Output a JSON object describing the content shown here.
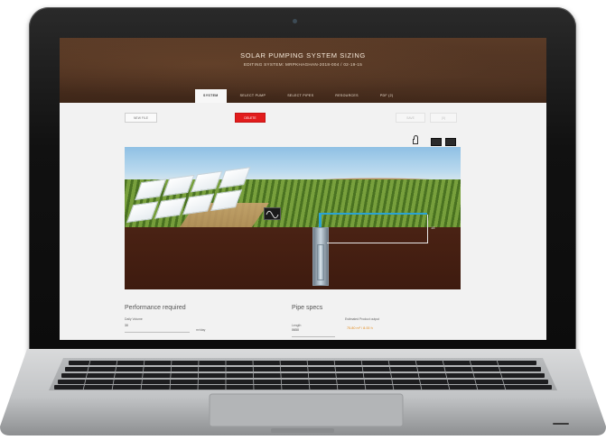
{
  "app": {
    "title": "SOLAR PUMPING SYSTEM SIZING",
    "subtitle": "EDITING SYSTEM: MRPKHAGHAN-2018-004 / 02-19-15"
  },
  "tabs": [
    {
      "label": "SYSTEM",
      "active": true
    },
    {
      "label": "SELECT PUMP",
      "active": false
    },
    {
      "label": "SELECT PIPES",
      "active": false
    },
    {
      "label": "RESOURCES",
      "active": false
    },
    {
      "label": "PDF (2)",
      "active": false
    }
  ],
  "toolbar": {
    "new_file": "NEW FILE",
    "delete": "DELETE",
    "save": "SAVE",
    "copy": "(0)"
  },
  "scene": {
    "dimension_label": "15"
  },
  "performance": {
    "title": "Performance required",
    "daily_volume_label": "Daily Volume",
    "daily_volume_value": "30",
    "daily_volume_unit": "m³/day"
  },
  "pipe": {
    "title": "Pipe specs",
    "length_label": "Length",
    "length_value": "0650"
  },
  "estimated": {
    "label": "Estimated Product output",
    "value": "75.80 m³ / 8.00 h"
  },
  "colors": {
    "accent_red": "#e21c1c",
    "header_brown": "#4b2f1f",
    "pipe_blue": "#2aa3d4",
    "estimate_orange": "#e48b1c"
  }
}
